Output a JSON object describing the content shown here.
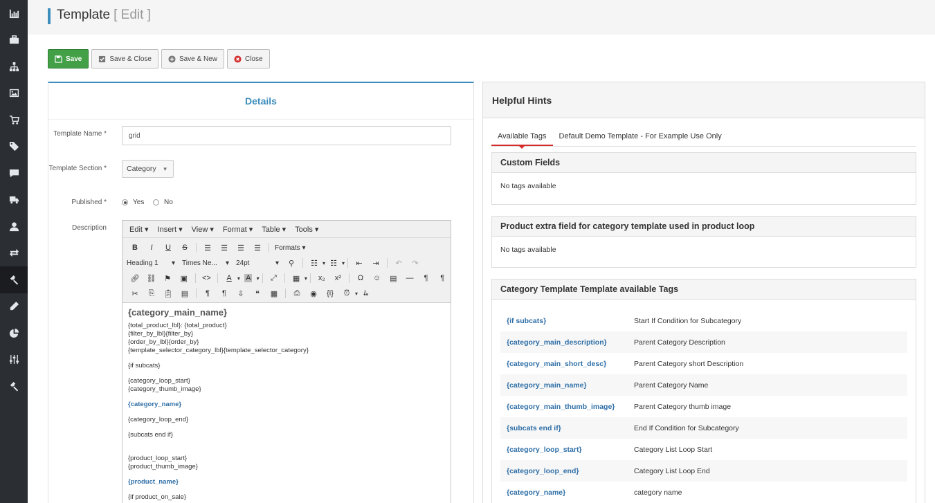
{
  "sidebar": {
    "icons": [
      "bar-chart-icon",
      "briefcase-icon",
      "sitemap-icon",
      "image-icon",
      "cart-icon",
      "tag-icon",
      "comment-icon",
      "truck-icon",
      "user-icon",
      "exchange-icon",
      "hammer-icon",
      "pencil-icon",
      "pie-chart-icon",
      "sliders-icon",
      "gavel-icon"
    ],
    "active_index": 10
  },
  "header": {
    "title": "Template",
    "subtitle": "[ Edit ]"
  },
  "toolbar": {
    "save": "Save",
    "save_close": "Save & Close",
    "save_new": "Save & New",
    "close": "Close"
  },
  "details": {
    "title": "Details",
    "template_name_label": "Template Name *",
    "template_name_value": "grid",
    "template_section_label": "Template Section *",
    "template_section_value": "Category",
    "published_label": "Published *",
    "published_yes": "Yes",
    "published_no": "No",
    "published_value": "Yes",
    "description_label": "Description"
  },
  "editor": {
    "menus": [
      "Edit",
      "Insert",
      "View",
      "Format",
      "Table",
      "Tools"
    ],
    "formats_label": "Formats",
    "heading_value": "Heading 1",
    "font_value": "Times Ne...",
    "size_value": "24pt",
    "content": {
      "heading": "{category_main_name}",
      "block1": [
        "{total_product_lbl}: {total_product}",
        "{filter_by_lbl}{filter_by}",
        "{order_by_lbl}{order_by}",
        "{template_selector_category_lbl}{template_selector_category}"
      ],
      "if_subcats": "{if subcats}",
      "block2": [
        "{category_loop_start}",
        "{category_thumb_image}"
      ],
      "category_name": "{category_name}",
      "category_loop_end": "{category_loop_end}",
      "subcats_end": "{subcats end if}",
      "block3": [
        "{product_loop_start}",
        "{product_thumb_image}"
      ],
      "product_name": "{product_name}",
      "if_sale": "{if product_on_sale}"
    }
  },
  "hints": {
    "title": "Helpful Hints",
    "tabs": [
      "Available Tags",
      "Default Demo Template - For Example Use Only"
    ],
    "custom_fields": {
      "title": "Custom Fields",
      "body": "No tags available"
    },
    "product_extra": {
      "title": "Product extra field for category template used in product loop",
      "body": "No tags available"
    },
    "category_tags": {
      "title": "Category Template Template available Tags",
      "rows": [
        {
          "tag": "{if subcats}",
          "desc": "Start If Condition for Subcategory"
        },
        {
          "tag": "{category_main_description}",
          "desc": "Parent Category Description"
        },
        {
          "tag": "{category_main_short_desc}",
          "desc": "Parent Category short Description"
        },
        {
          "tag": "{category_main_name}",
          "desc": "Parent Category Name"
        },
        {
          "tag": "{category_main_thumb_image}",
          "desc": "Parent Category thumb image"
        },
        {
          "tag": "{subcats end if}",
          "desc": "End If Condition for Subcategory"
        },
        {
          "tag": "{category_loop_start}",
          "desc": "Category List Loop Start"
        },
        {
          "tag": "{category_loop_end}",
          "desc": "Category List Loop End"
        },
        {
          "tag": "{category_name}",
          "desc": "category name"
        }
      ]
    }
  }
}
